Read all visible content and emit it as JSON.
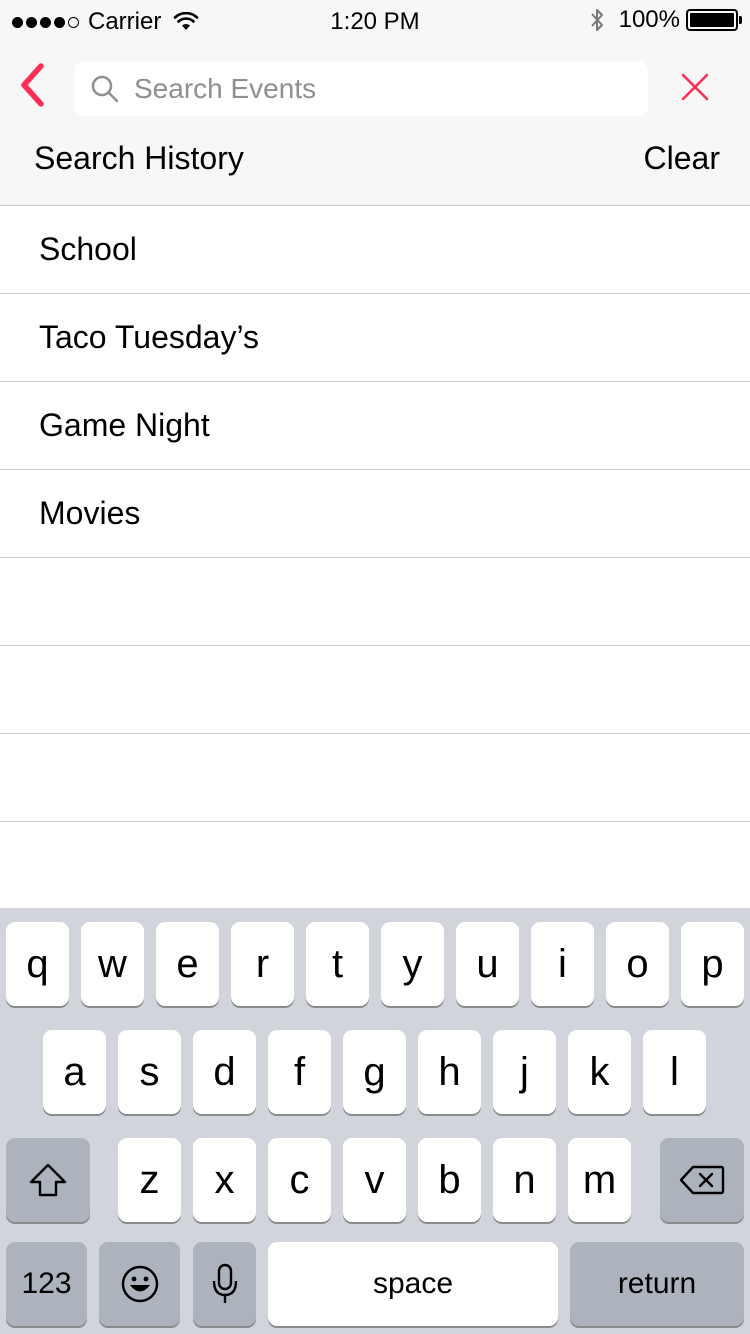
{
  "status_bar": {
    "carrier": "Carrier",
    "time": "1:20 PM",
    "battery": "100%"
  },
  "search": {
    "placeholder": "Search Events",
    "value": ""
  },
  "history": {
    "title": "Search History",
    "clear_label": "Clear",
    "items": [
      "School",
      "Taco Tuesday’s",
      "Game Night",
      "Movies"
    ]
  },
  "keyboard": {
    "row1": [
      "q",
      "w",
      "e",
      "r",
      "t",
      "y",
      "u",
      "i",
      "o",
      "p"
    ],
    "row2": [
      "a",
      "s",
      "d",
      "f",
      "g",
      "h",
      "j",
      "k",
      "l"
    ],
    "row3": [
      "z",
      "x",
      "c",
      "v",
      "b",
      "n",
      "m"
    ],
    "numbers_label": "123",
    "space_label": "space",
    "return_label": "return"
  },
  "colors": {
    "accent": "#ff2d55",
    "header_bg": "#f7f7f7",
    "keyboard_bg": "#d1d4db"
  },
  "icons": [
    "back-chevron-icon",
    "search-icon",
    "close-icon",
    "wifi-icon",
    "bluetooth-icon",
    "battery-icon",
    "shift-icon",
    "delete-icon",
    "emoji-icon",
    "microphone-icon"
  ]
}
